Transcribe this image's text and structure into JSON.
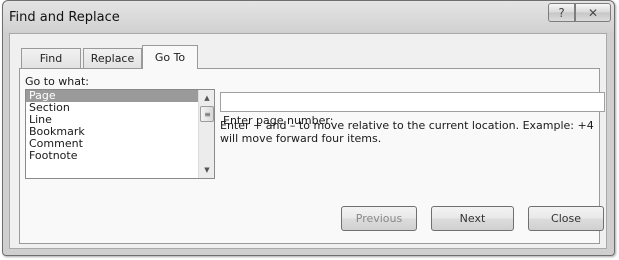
{
  "window": {
    "title": "Find and Replace",
    "help_glyph": "?",
    "close_glyph": "✕"
  },
  "tabs": [
    {
      "label": "Find"
    },
    {
      "label": "Replace"
    },
    {
      "label": "Go To",
      "active": true
    }
  ],
  "goto": {
    "go_to_what_label": "Go to what:",
    "items": [
      "Page",
      "Section",
      "Line",
      "Bookmark",
      "Comment",
      "Footnote"
    ],
    "selected_item": "Page",
    "page_number_label": "Enter page number:",
    "page_number_value": "",
    "hint": "Enter + and – to move relative to the current location. Example: +4 will move forward four items."
  },
  "buttons": {
    "previous": "Previous",
    "next": "Next",
    "close": "Close"
  },
  "icons": {
    "scroll_up": "▲",
    "scroll_down": "▼",
    "scroll_thumb": "≡"
  }
}
